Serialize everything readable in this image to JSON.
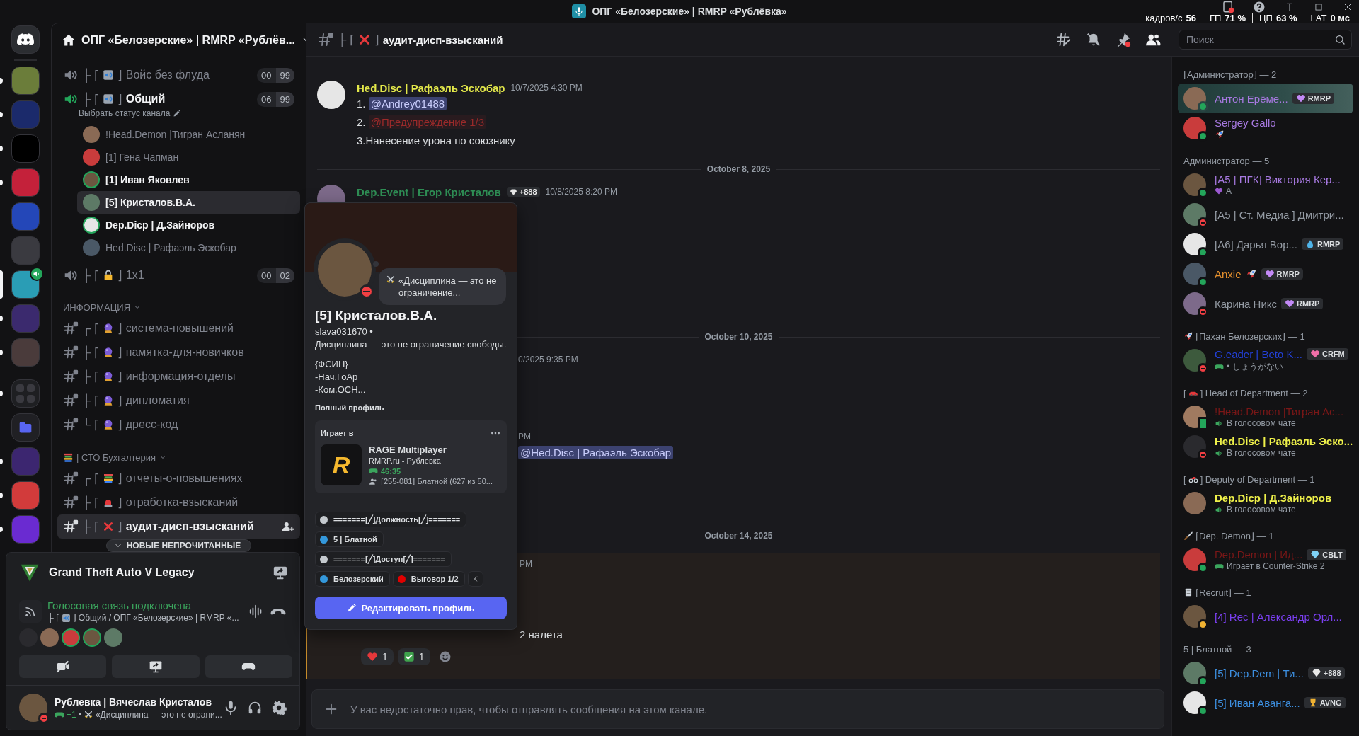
{
  "title_bar": {
    "title": "ОПГ «Белозерские» | RMRP «Рублёвка»",
    "stats": [
      {
        "label": "кадров/с",
        "value": "56"
      },
      {
        "label": "ГП",
        "value": "71 %"
      },
      {
        "label": "ЦП",
        "value": "63 %"
      },
      {
        "label": "LAT",
        "value": "0 мс"
      }
    ]
  },
  "server_rail": {
    "servers": [
      {
        "kind": "home",
        "selected": false,
        "unread": false,
        "voice": false
      },
      {
        "kind": "server",
        "selected": false,
        "unread": true,
        "voice": false
      },
      {
        "kind": "server",
        "selected": false,
        "unread": true,
        "voice": false
      },
      {
        "kind": "server",
        "selected": false,
        "unread": true,
        "voice": false
      },
      {
        "kind": "server",
        "selected": false,
        "unread": true,
        "voice": false
      },
      {
        "kind": "server",
        "selected": false,
        "unread": false,
        "voice": false
      },
      {
        "kind": "server",
        "selected": false,
        "unread": false,
        "voice": false
      },
      {
        "kind": "server",
        "selected": true,
        "unread": false,
        "voice": true
      },
      {
        "kind": "server",
        "selected": false,
        "unread": true,
        "voice": false
      },
      {
        "kind": "server",
        "selected": false,
        "unread": true,
        "voice": false
      },
      {
        "kind": "stack",
        "selected": false,
        "unread": true,
        "voice": false
      },
      {
        "kind": "folder",
        "selected": false,
        "unread": false,
        "voice": false
      },
      {
        "kind": "server",
        "selected": false,
        "unread": true,
        "voice": false
      },
      {
        "kind": "server",
        "selected": false,
        "unread": true,
        "voice": false
      },
      {
        "kind": "server",
        "selected": false,
        "unread": true,
        "voice": false
      }
    ]
  },
  "channel_sidebar": {
    "server_name": "ОПГ «Белозерские» | RMRP «Рублёв...",
    "voice_channels": [
      {
        "kind": "speaker",
        "prefix": "├ ⌈",
        "suffix": "⌋",
        "name": "Войс без флуда",
        "active": false,
        "count": "00",
        "limit": "99"
      },
      {
        "kind": "speaker",
        "prefix": "├ ⌈",
        "suffix": "⌋",
        "name": "Общий",
        "active": true,
        "count": "06",
        "limit": "99",
        "status_hint": "Выбрать статус канала",
        "members": [
          {
            "name": "!Head.Demon |Тигран Асланян",
            "speaking": false,
            "selected": false
          },
          {
            "name": "[1] Гена Чапман",
            "speaking": false,
            "selected": false
          },
          {
            "name": "[1] Иван Яковлев",
            "speaking": true,
            "selected": false
          },
          {
            "name": "[5] Кристалов.В.А.",
            "speaking": false,
            "selected": true
          },
          {
            "name": "Dep.Dicp | Д.Зайноров",
            "speaking": true,
            "selected": false
          },
          {
            "name": "Hed.Disc | Рафаэль Эскобар",
            "speaking": false,
            "selected": false
          }
        ]
      },
      {
        "kind": "lock",
        "prefix": "├ ⌈",
        "suffix": "⌋",
        "name": "1x1",
        "active": false,
        "count": "00",
        "limit": "02"
      }
    ],
    "categories": [
      {
        "kind": "plain",
        "name": "ИНФОРМАЦИЯ",
        "channels": [
          {
            "kind": "orb",
            "prefix": "┌ ⌈",
            "suffix": "⌋",
            "name": "система-повышений",
            "selected": false
          },
          {
            "kind": "orb",
            "prefix": "├ ⌈",
            "suffix": "⌋",
            "name": "памятка-для-новичков",
            "selected": false
          },
          {
            "kind": "orb",
            "prefix": "├ ⌈",
            "suffix": "⌋",
            "name": "информация-отделы",
            "selected": false
          },
          {
            "kind": "orb",
            "prefix": "├ ⌈",
            "suffix": "⌋",
            "name": "дипломатия",
            "selected": false
          },
          {
            "kind": "orb",
            "prefix": "└ ⌈",
            "suffix": "⌋",
            "name": "дресс-код",
            "selected": false
          }
        ]
      },
      {
        "kind": "books",
        "name": "| СТО Бухгалтерия",
        "channels": [
          {
            "kind": "books",
            "prefix": "┌ ⌈",
            "suffix": "⌋",
            "name": "отчеты-о-повышениях",
            "selected": false
          },
          {
            "kind": "siren",
            "prefix": "├ ⌈",
            "suffix": "⌋",
            "name": "отработка-взысканий",
            "selected": false
          },
          {
            "kind": "cross",
            "prefix": "├ ⌈",
            "suffix": "⌋",
            "name": "аудит-дисп-взысканий",
            "selected": true
          }
        ]
      }
    ],
    "new_unread": "НОВЫЕ НЕПРОЧИТАННЫЕ"
  },
  "voice_panel": {
    "activity": "Grand Theft Auto V Legacy",
    "status": "Голосовая связь подключена",
    "channel_prefix": "├ ⌈",
    "channel_suffix": "⌋",
    "channel_path": "Общий / ОПГ «Белозерские» | RMRP «...",
    "participants": [
      {
        "speaking": false
      },
      {
        "speaking": false
      },
      {
        "speaking": true
      },
      {
        "speaking": true
      },
      {
        "speaking": false
      }
    ],
    "user": {
      "name": "Рублевка | Вячеслав Кристалов",
      "presence": {
        "kind": "dnd",
        "color": "#f23f43"
      },
      "activity": "+1",
      "separator": "•",
      "custom_status": "«Дисциплина — это не ограни..."
    }
  },
  "chat": {
    "channel": {
      "prefix": "├ ⌈",
      "suffix": "⌋",
      "name": "аудит-дисп-взысканий"
    },
    "search_placeholder": "Поиск",
    "messages": [
      {
        "kind": "message",
        "author": "Hed.Disc | Рафаэль Эскобар",
        "color": "#e3e84a",
        "timestamp": "10/7/2025 4:30 PM",
        "highlighted": false,
        "lines": [
          {
            "kind": "mention",
            "number": "1.",
            "text": "@Andrey01488"
          },
          {
            "kind": "role",
            "number": "2.",
            "text": "@Предупреждение 1/3"
          },
          {
            "kind": "text",
            "text": "3.Нанесение урона по союзнику"
          }
        ]
      },
      {
        "kind": "divider",
        "text": "October 8, 2025"
      },
      {
        "kind": "message",
        "author": "Dep.Event | Егор Кристалов",
        "color": "#2f8f55",
        "badge": "+888",
        "timestamp": "10/8/2025 8:20 PM",
        "highlighted": false
      },
      {
        "kind": "divider",
        "text": "October 10, 2025"
      },
      {
        "kind": "fragment",
        "highlighted": false,
        "lines": [
          {
            "kind": "timestamp",
            "text": "0/2025 9:35 PM"
          }
        ]
      },
      {
        "kind": "fragment",
        "highlighted": false,
        "lines": [
          {
            "kind": "timestamp",
            "text": "PM"
          },
          {
            "kind": "mention",
            "text": "@Hed.Disc | Рафаэль Эскобар"
          }
        ]
      },
      {
        "kind": "divider",
        "text": "October 14, 2025"
      },
      {
        "kind": "fragment",
        "highlighted": true,
        "lines": [
          {
            "kind": "timestamp",
            "text": "PM"
          },
          {
            "kind": "text",
            "text": "2 налета"
          }
        ],
        "reactions": [
          {
            "kind": "heart",
            "count": "1"
          },
          {
            "kind": "check",
            "count": "1"
          }
        ]
      }
    ],
    "composer_placeholder": "У вас недостаточно прав, чтобы отправлять сообщения на этом канале."
  },
  "profile_popup": {
    "presence": {
      "kind": "dnd",
      "color": "#f23f43"
    },
    "status_text": "«Дисциплина — это не ограничение...",
    "display_name": "[5] Кристалов.В.А.",
    "username": "slava031670 •",
    "bio": [
      "Дисциплина — это не ограничение свободы.",
      "{ФСИН}",
      "-Нач.ГоАр",
      "-Ком.ОСН..."
    ],
    "full_profile": "Полный профиль",
    "activity": {
      "heading": "Играет в",
      "logo": "R",
      "game": "RAGE Multiplayer",
      "details": "RMRP.ru - Рублевка",
      "elapsed": "46:35",
      "party": "⌈255-081⌋ Блатной (627 из 50..."
    },
    "roles": [
      {
        "name": "=======[╱]Должность[╱]=======",
        "color": "#c4c9ce"
      },
      {
        "name": "5 | Блатной",
        "color": "#3498db"
      },
      {
        "name": "=======[╱]Доступ[╱]=======",
        "color": "#c4c9ce"
      },
      {
        "name": "Белозерский",
        "color": "#3498db"
      },
      {
        "name": "Выговор 1/2",
        "color": "#e00000"
      }
    ],
    "edit_button": "Редактировать профиль"
  },
  "member_list": {
    "groups": [
      {
        "parts": [
          {
            "kind": "text",
            "text": "⌈Администратор⌋ — 2"
          }
        ],
        "members": [
          {
            "name": "Антон Ерёме...",
            "color": "#a779e0",
            "presence": {
              "kind": "online",
              "color": "#23a55a"
            },
            "highlighted": true,
            "badge": {
              "kind": "heart",
              "text": "RMRP",
              "color": "#c38af7"
            }
          },
          {
            "name": "Sergey Gallo",
            "color": "#a779e0",
            "presence": {
              "kind": "online",
              "color": "#23a55a"
            },
            "highlighted": false,
            "sub": {
              "kind": "rocket"
            }
          }
        ]
      },
      {
        "parts": [
          {
            "kind": "text",
            "text": "Администратор — 5"
          }
        ],
        "members": [
          {
            "name": "[А5 | ПГК] Виктория Кер...",
            "color": "#a779e0",
            "presence": {
              "kind": "online",
              "color": "#23a55a"
            },
            "highlighted": false,
            "sub": {
              "kind": "heart",
              "text": "A"
            }
          },
          {
            "name": "[А5 | Ст. Медиа ] Дмитри...",
            "color": "#949ba4",
            "presence": {
              "kind": "dnd",
              "color": "#f23f43"
            },
            "highlighted": false
          },
          {
            "name": "[А6] Дарья Вор...",
            "color": "#949ba4",
            "presence": {
              "kind": "online",
              "color": "#23a55a"
            },
            "highlighted": false,
            "badge": {
              "kind": "drop",
              "text": "RMRP",
              "color": "#4fb3e8"
            }
          },
          {
            "name": "Anxie",
            "color": "#e6912e",
            "presence": {
              "kind": "online",
              "color": "#23a55a"
            },
            "highlighted": false,
            "tag": {
              "kind": "rocket"
            },
            "badge": {
              "kind": "heart",
              "text": "RMRP",
              "color": "#c38af7"
            }
          },
          {
            "name": "Карина Никс",
            "color": "#949ba4",
            "presence": {
              "kind": "dnd",
              "color": "#f23f43"
            },
            "highlighted": false,
            "badge": {
              "kind": "heart",
              "text": "RMRP",
              "color": "#c38af7"
            }
          }
        ]
      },
      {
        "parts": [
          {
            "kind": "rocket"
          },
          {
            "kind": "text",
            "text": "⌈Пахан Белозерских⌋ — 1"
          }
        ],
        "members": [
          {
            "name": "G.eader | Beto K...",
            "color": "#2340d8",
            "presence": {
              "kind": "dnd",
              "color": "#f23f43"
            },
            "highlighted": false,
            "badge": {
              "kind": "heart",
              "text": "CRFM",
              "color": "#f06fa8"
            },
            "sub": {
              "kind": "gamepad",
              "text": "• しょうがない"
            }
          }
        ]
      },
      {
        "parts": [
          {
            "kind": "text",
            "text": "["
          },
          {
            "kind": "car"
          },
          {
            "kind": "text",
            "text": "] Head of Department — 2"
          }
        ],
        "members": [
          {
            "name": "!Head.Demon |Тигран Ас...",
            "color": "#7a1717",
            "presence": {
              "kind": "mobile",
              "color": "#23a55a"
            },
            "highlighted": false,
            "sub": {
              "kind": "voice",
              "text": "В голосовом чате"
            }
          },
          {
            "name": "Hed.Disc | Рафаэль Эско...",
            "color": "#eef04a",
            "presence": {
              "kind": "dnd",
              "color": "#f23f43"
            },
            "highlighted": false,
            "sub": {
              "kind": "voice",
              "text": "В голосовом чате"
            }
          }
        ]
      },
      {
        "parts": [
          {
            "kind": "text",
            "text": "["
          },
          {
            "kind": "moto"
          },
          {
            "kind": "text",
            "text": "] Deputy of Department — 1"
          }
        ],
        "members": [
          {
            "name": "Dep.Dicp | Д.Зайноров",
            "color": "#eef04a",
            "highlighted": false,
            "sub": {
              "kind": "voice",
              "text": "В голосовом чате"
            }
          }
        ]
      },
      {
        "parts": [
          {
            "kind": "knife"
          },
          {
            "kind": "text",
            "text": "⌈Dep. Demon⌋ — 1"
          }
        ],
        "members": [
          {
            "name": "Dep.Demon | Ид...",
            "color": "#7a1717",
            "presence": {
              "kind": "online",
              "color": "#23a55a"
            },
            "highlighted": false,
            "badge": {
              "kind": "gem",
              "text": "CBLT",
              "color": "#7fd3f7"
            },
            "sub": {
              "kind": "gamepad",
              "text": "Играет в Counter-Strike 2"
            }
          }
        ]
      },
      {
        "parts": [
          {
            "kind": "notebook"
          },
          {
            "kind": "text",
            "text": "⌈Recruit⌋ — 1"
          }
        ],
        "members": [
          {
            "name": "[4] Rec | Александр Орл...",
            "color": "#7a3ff0",
            "presence": {
              "kind": "idle",
              "color": "#f0b232"
            },
            "highlighted": false
          }
        ]
      },
      {
        "parts": [
          {
            "kind": "text",
            "text": "5 | Блатной — 3"
          }
        ],
        "members": [
          {
            "name": "[5] Dep.Dem | Ти...",
            "color": "#3d8fe0",
            "presence": {
              "kind": "online",
              "color": "#23a55a"
            },
            "highlighted": false,
            "badge": {
              "kind": "gem",
              "text": "+888",
              "color": "#e8e8e8"
            }
          },
          {
            "name": "[5] Иван Аванга...",
            "color": "#3d8fe0",
            "presence": {
              "kind": "online",
              "color": "#23a55a"
            },
            "highlighted": false,
            "badge": {
              "kind": "trophy",
              "text": "AVNG",
              "color": "#f0b232"
            }
          }
        ]
      }
    ]
  }
}
